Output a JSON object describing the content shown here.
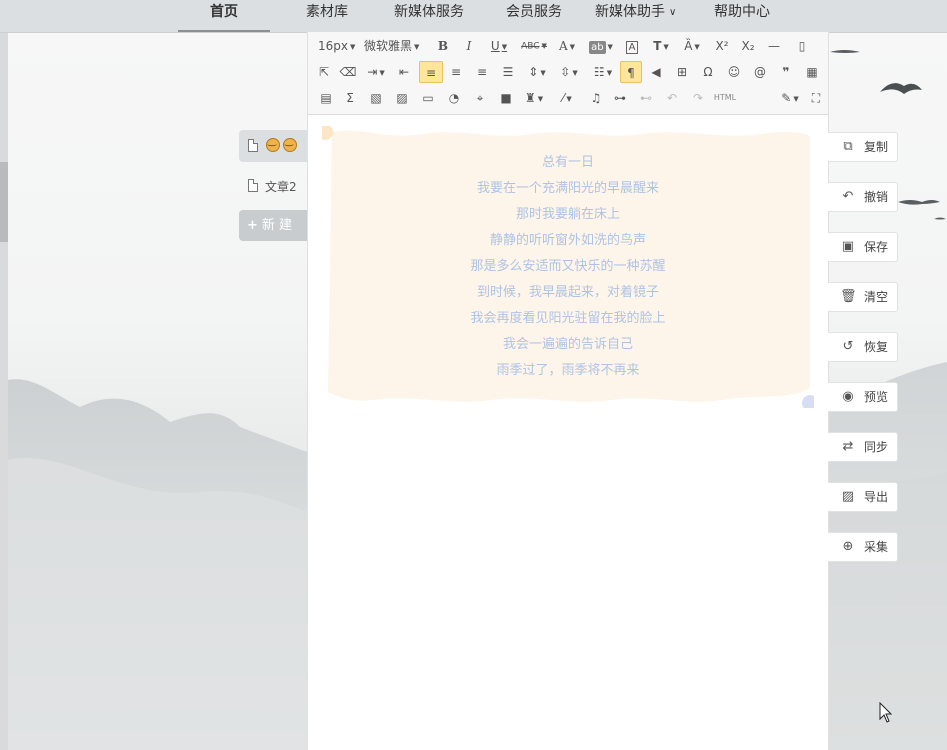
{
  "nav": {
    "items": [
      {
        "label": "首页",
        "active": true
      },
      {
        "label": "素材库"
      },
      {
        "label": "新媒体服务"
      },
      {
        "label": "会员服务"
      },
      {
        "label": "新媒体助手"
      },
      {
        "label": "帮助中心"
      }
    ]
  },
  "articles": {
    "items": [
      {
        "label": "",
        "icon": "emoji-icon",
        "selected": true
      },
      {
        "label": "文章2"
      }
    ],
    "new_label": "新 建"
  },
  "toolbar": {
    "font_size": "16px",
    "font_family": "微软雅黑",
    "html_label": "HTML",
    "icons_row1": [
      "bold-icon",
      "italic-icon",
      "underline-icon",
      "strikethrough-icon",
      "font-color-icon",
      "background-color-icon",
      "border-icon",
      "text-effect-icon",
      "font-size-icon",
      "superscript-icon",
      "subscript-icon",
      "horizontal-rule-icon",
      "new-page-icon"
    ],
    "icons_row2": [
      "select-icon",
      "eraser-icon",
      "indent-icon",
      "outdent-icon",
      "align-left-icon",
      "align-center-icon",
      "align-right-icon",
      "align-justify-icon",
      "line-spacing-icon",
      "paragraph-spacing-icon",
      "list-icon",
      "ltr-icon",
      "rtl-icon",
      "drawing-icon",
      "special-char-icon",
      "emoji-face-icon",
      "at-icon",
      "quote-icon",
      "table-icon"
    ],
    "icons_row3": [
      "template-icon",
      "formula-icon",
      "image-icon",
      "image-gallery-icon",
      "layout-icon",
      "chart-icon",
      "map-icon",
      "video-icon",
      "format-brush-icon",
      "magic-wand-icon",
      "music-icon",
      "link-icon",
      "unlink-icon",
      "undo-icon",
      "redo-icon",
      "html-icon",
      "edit-icon",
      "fullscreen-icon"
    ]
  },
  "content": {
    "lines": [
      "总有一日",
      "我要在一个充满阳光的早晨醒来",
      "那时我要躺在床上",
      "静静的听听窗外如洗的鸟声",
      "那是多么安适而又快乐的一种苏醒",
      "到时候，我早晨起来，对着镜子",
      "我会再度看见阳光驻留在我的脸上",
      "我会一遍遍的告诉自己",
      "雨季过了，雨季将不再来"
    ],
    "colors": {
      "text": "#aec3e4",
      "card": "#fdf5ea",
      "dot_orange": "#fde6c5",
      "dot_blue": "#d6def4"
    }
  },
  "side": {
    "buttons": [
      {
        "label": "复制",
        "icon": "copy-icon",
        "glyph": "⧉"
      },
      {
        "label": "撤销",
        "icon": "undo-arrow-icon",
        "glyph": "↶"
      },
      {
        "label": "保存",
        "icon": "save-icon",
        "glyph": "▣"
      },
      {
        "label": "清空",
        "icon": "trash-icon",
        "glyph": "🗑"
      },
      {
        "label": "恢复",
        "icon": "restore-icon",
        "glyph": "↺"
      },
      {
        "label": "预览",
        "icon": "eye-icon",
        "glyph": "◉"
      },
      {
        "label": "同步",
        "icon": "sync-icon",
        "glyph": "⇄"
      },
      {
        "label": "导出",
        "icon": "export-image-icon",
        "glyph": "▨"
      },
      {
        "label": "采集",
        "icon": "search-zoom-icon",
        "glyph": "⊕"
      }
    ]
  }
}
